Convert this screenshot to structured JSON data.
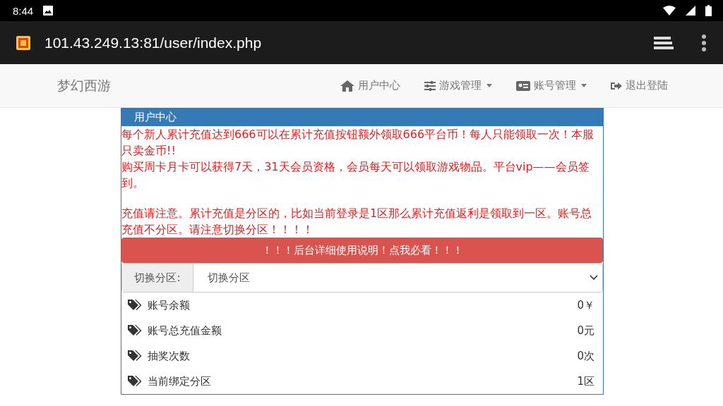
{
  "status_bar": {
    "time": "8:44"
  },
  "browser": {
    "url": "101.43.249.13:81/user/index.php"
  },
  "navbar": {
    "brand": "梦幻西游",
    "items": [
      {
        "kind": "home",
        "label": "用户中心",
        "dropdown": false
      },
      {
        "kind": "sliders",
        "label": "游戏管理",
        "dropdown": true
      },
      {
        "kind": "card",
        "label": "账号管理",
        "dropdown": true
      },
      {
        "kind": "logout",
        "label": "退出登陆",
        "dropdown": false
      }
    ]
  },
  "panel": {
    "title": "用户中心",
    "notices": [
      {
        "text": "每个新人累计充值达到666可以在累计充值按钮额外领取666平台币！每人只能领取一次！本服只卖金币!!",
        "space_before": false
      },
      {
        "text": "购买周卡月卡可以获得7天，31天会员资格，会员每天可以领取游戏物品。平台vip——会员签到。",
        "space_before": false
      },
      {
        "text": "充值请注意。累计充值是分区的，比如当前登录是1区那么累计充值返利是领取到一区。账号总充值不分区。请注意切换分区！！！！",
        "space_before": true
      }
    ],
    "guide_button": "！！！后台详细使用说明！点我必看！！！",
    "zone_select": {
      "label": "切换分区:",
      "value": "切换分区"
    },
    "stats": [
      {
        "label": "账号余额",
        "value": "0￥"
      },
      {
        "label": "账号总充值金额",
        "value": "0元"
      },
      {
        "label": "抽奖次数",
        "value": "0次"
      },
      {
        "label": "当前绑定分区",
        "value": "1区"
      }
    ]
  }
}
